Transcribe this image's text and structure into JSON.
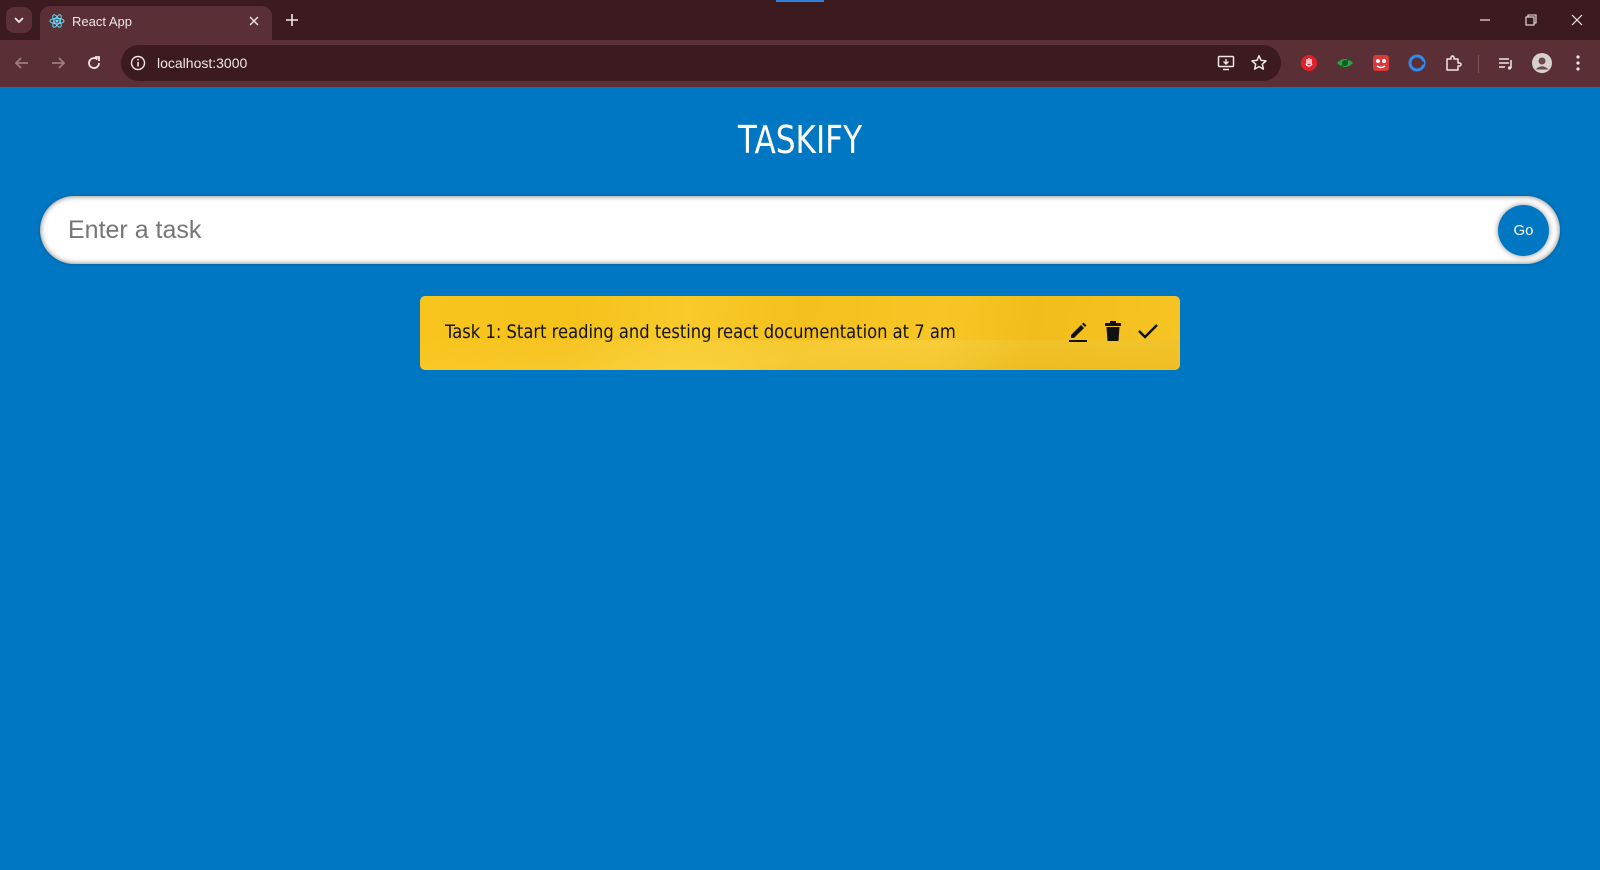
{
  "browser": {
    "tab_title": "React App",
    "url": "localhost:3000"
  },
  "app": {
    "title": "TASKIFY",
    "input_placeholder": "Enter a task",
    "go_label": "Go"
  },
  "tasks": [
    {
      "text": "Task 1: Start reading and testing react documentation at 7 am"
    }
  ],
  "colors": {
    "page_background": "#0077c2",
    "task_card": "#f7c51d",
    "chrome_dark": "#3b1b20",
    "chrome_toolbar": "#5a2f36"
  },
  "icons": {
    "task_actions": [
      "edit-icon",
      "delete-icon",
      "done-icon"
    ]
  }
}
